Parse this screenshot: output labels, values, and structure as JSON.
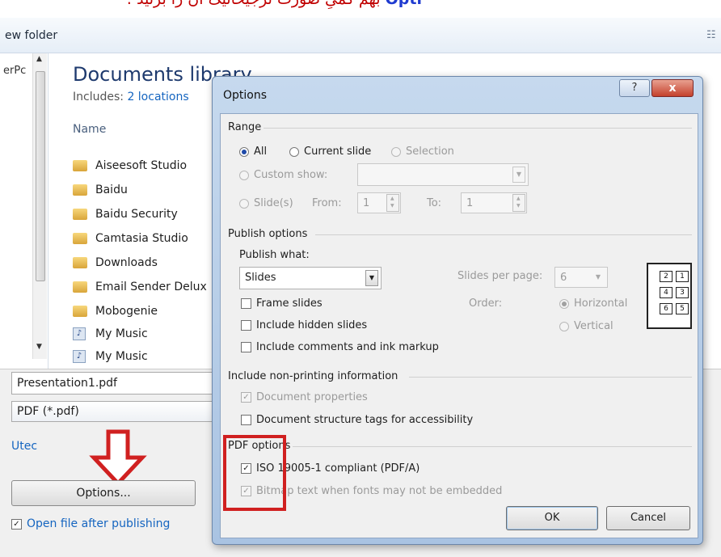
{
  "caption": {
    "prefix": "Opti",
    "text": "بهم کمیِ صورت ترجیحاتیک آن را برنید :"
  },
  "background_dialog": {
    "toolbar": {
      "new_folder": "ew folder"
    },
    "nav": {
      "item": "erPc"
    },
    "library": {
      "title": "Documents library",
      "includes_label": "Includes:",
      "includes_link": "2 locations",
      "column_name": "Name",
      "items": [
        {
          "label": "Aiseesoft Studio",
          "icon": "folder-icon"
        },
        {
          "label": "Baidu",
          "icon": "folder-icon"
        },
        {
          "label": "Baidu Security",
          "icon": "folder-icon"
        },
        {
          "label": "Camtasia Studio",
          "icon": "folder-icon"
        },
        {
          "label": "Downloads",
          "icon": "folder-icon"
        },
        {
          "label": "Email Sender Delux",
          "icon": "folder-icon"
        },
        {
          "label": "Mobogenie",
          "icon": "folder-icon"
        },
        {
          "label": "My Music",
          "icon": "music-folder-icon"
        },
        {
          "label": "My Music",
          "icon": "music-folder-icon"
        }
      ]
    },
    "file_name": "Presentation1.pdf",
    "file_type": "PDF (*.pdf)",
    "utec": "Utec",
    "options_button": "Options...",
    "open_after_publishing": "Open file after publishing",
    "open_after_checked": true
  },
  "options_dialog": {
    "title": "Options",
    "help": "?",
    "close": "x",
    "range": {
      "heading": "Range",
      "all": "All",
      "current_slide": "Current slide",
      "selection": "Selection",
      "custom_show": "Custom show:",
      "slides": "Slide(s)",
      "from_label": "From:",
      "from_value": "1",
      "to_label": "To:",
      "to_value": "1"
    },
    "publish": {
      "heading": "Publish options",
      "publish_what_label": "Publish what:",
      "publish_what_value": "Slides",
      "slides_per_page_label": "Slides per page:",
      "slides_per_page_value": "6",
      "order_label": "Order:",
      "horizontal": "Horizontal",
      "vertical": "Vertical",
      "frame_slides": "Frame slides",
      "include_hidden": "Include hidden slides",
      "include_comments": "Include comments and ink markup",
      "layout_cells": [
        "2",
        "1",
        "4",
        "3",
        "6",
        "5"
      ]
    },
    "nonprinting": {
      "heading": "Include non-printing information",
      "document_properties": "Document properties",
      "structure_tags": "Document structure tags for accessibility"
    },
    "pdf": {
      "heading": "PDF options",
      "iso": "ISO 19005-1 compliant (PDF/A)",
      "bitmap": "Bitmap text when fonts may not be embedded"
    },
    "ok": "OK",
    "cancel": "Cancel"
  },
  "colors": {
    "highlight": "#d02020",
    "link": "#1565c0"
  }
}
